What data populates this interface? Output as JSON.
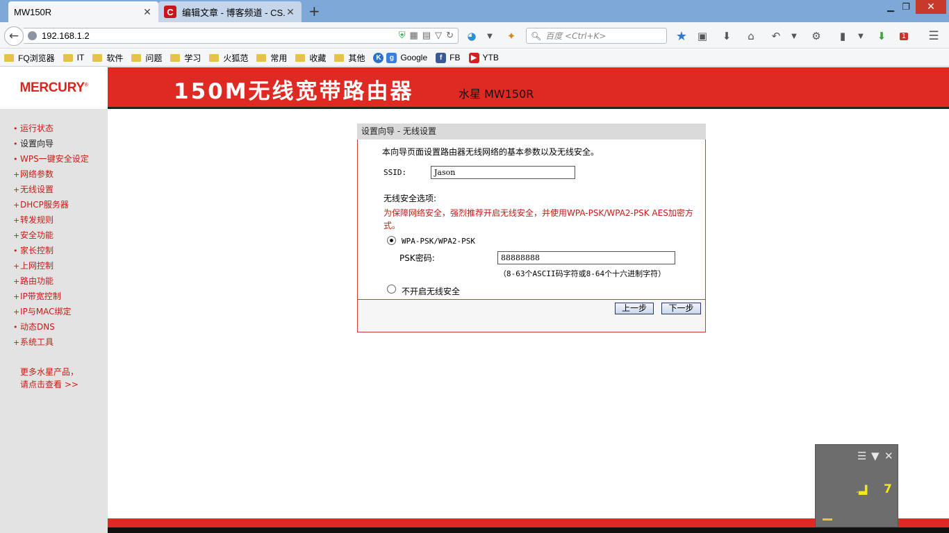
{
  "browser": {
    "active_tab": "MW150R",
    "second_tab": "编辑文章 - 博客频道 - CS...",
    "second_tab_logo": "C",
    "new_tab_glyph": "+",
    "url": "192.168.1.2",
    "search_placeholder": "百度 <Ctrl+K>",
    "bookmarks": [
      {
        "label": "FQ浏览器",
        "icon": "folder-icon"
      },
      {
        "label": "IT",
        "icon": "folder-icon"
      },
      {
        "label": "软件",
        "icon": "folder-icon"
      },
      {
        "label": "问题",
        "icon": "folder-icon"
      },
      {
        "label": "学习",
        "icon": "folder-icon"
      },
      {
        "label": "火狐范",
        "icon": "folder-icon"
      },
      {
        "label": "常用",
        "icon": "folder-icon"
      },
      {
        "label": "收藏",
        "icon": "folder-icon"
      },
      {
        "label": "其他",
        "icon": "folder-icon"
      },
      {
        "label": "Google",
        "icon": "google-icon",
        "badge": "g",
        "color": "#3b7fd7"
      },
      {
        "label": "FB",
        "icon": "facebook-icon",
        "badge": "f",
        "color": "#3b5998"
      },
      {
        "label": "YTB",
        "icon": "youtube-icon",
        "badge": "▶",
        "color": "#d71f1f"
      }
    ],
    "k_badge": "K",
    "addon_badge": "1"
  },
  "router": {
    "logo": "MERCURY",
    "logo_mark": "®",
    "product_title": "150M无线宽带路由器",
    "product_sub": "水星 MW150R",
    "menu": [
      {
        "label": "运行状态",
        "bullet": "•"
      },
      {
        "label": "设置向导",
        "bullet": "•",
        "current": true
      },
      {
        "label": "WPS一键安全设定",
        "bullet": "•"
      },
      {
        "label": "网络参数",
        "bullet": "+"
      },
      {
        "label": "无线设置",
        "bullet": "+"
      },
      {
        "label": "DHCP服务器",
        "bullet": "+"
      },
      {
        "label": "转发规则",
        "bullet": "+"
      },
      {
        "label": "安全功能",
        "bullet": "+"
      },
      {
        "label": "家长控制",
        "bullet": "•"
      },
      {
        "label": "上网控制",
        "bullet": "+"
      },
      {
        "label": "路由功能",
        "bullet": "+"
      },
      {
        "label": "IP带宽控制",
        "bullet": "+"
      },
      {
        "label": "IP与MAC绑定",
        "bullet": "+"
      },
      {
        "label": "动态DNS",
        "bullet": "•"
      },
      {
        "label": "系统工具",
        "bullet": "+"
      }
    ],
    "more_line1": "更多水星产品，",
    "more_line2": "请点击查看 >>"
  },
  "wizard": {
    "title": "设置向导 - 无线设置",
    "intro": "本向导页面设置路由器无线网络的基本参数以及无线安全。",
    "ssid_label": "SSID:",
    "ssid_value": "Jason",
    "security_heading": "无线安全选项:",
    "warning_line1": "为保障网络安全，强烈推荐开启无线安全，并使用WPA-PSK/WPA2-PSK AES加密方",
    "warning_line2": "式。",
    "option_wpa": "WPA-PSK/WPA2-PSK",
    "psk_label": "PSK密码:",
    "psk_value": "88888888",
    "psk_hint": "（8-63个ASCII码字符或8-64个十六进制字符）",
    "option_none": "不开启无线安全",
    "selected_option": "WPA-PSK/WPA2-PSK",
    "btn_prev": "上一步",
    "btn_next": "下一步"
  },
  "widget": {
    "level": "7",
    "signal_glyph": ".▃▍"
  },
  "colors": {
    "brand_red": "#de2a22",
    "menu_red": "#c41d16"
  }
}
